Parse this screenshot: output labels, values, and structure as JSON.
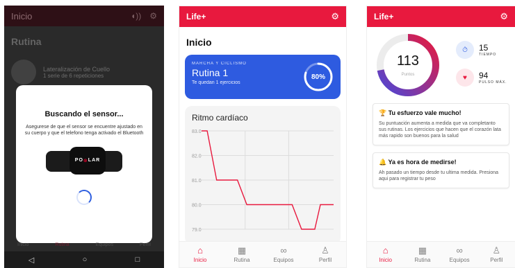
{
  "phone1": {
    "header_title": "Inicio",
    "section_title": "Rutina",
    "item_title": "Lateralización de Cuello",
    "item_sub": "1 serie de 6 repeticiones",
    "modal_title": "Buscando el sensor...",
    "modal_text": "Asegurese de que el sensor se encuentre ajustado en su cuerpo y que el telefono tenga activado el Bluetooth",
    "sensor_brand_left": "PO",
    "sensor_brand_right": "LAR",
    "tabs": [
      "Inicio",
      "Rutina",
      "Equipos",
      "Perfil"
    ]
  },
  "phone2": {
    "app_title": "Life+",
    "page_title": "Inicio",
    "routine": {
      "category": "MARCHA Y CICLISMO",
      "name": "Rutina 1",
      "remaining": "Te quedan 1 ejercicios",
      "progress_label": "80%",
      "progress": 0.8
    },
    "hr_title": "Ritmo cardíaco",
    "chart_data": {
      "type": "line",
      "title": "Ritmo cardíaco",
      "ytick_labels": [
        "83.0",
        "82.0",
        "81.0",
        "80.0",
        "79.0"
      ],
      "ylim": [
        79,
        83
      ],
      "series": [
        {
          "values": [
            83,
            83,
            81,
            81,
            81,
            80,
            80,
            80,
            80,
            80,
            79,
            79,
            80,
            80
          ]
        }
      ],
      "x_index": [
        0,
        0.6,
        1.6,
        3.0,
        3.8,
        4.8,
        6.0,
        7.2,
        8.4,
        9.6,
        10.6,
        12.0,
        12.6,
        14.0
      ],
      "grid": true,
      "color": "#e8193e"
    },
    "nav": [
      {
        "label": "Inicio",
        "icon": "home-icon",
        "active": true
      },
      {
        "label": "Rutina",
        "icon": "calendar-icon",
        "active": false
      },
      {
        "label": "Equipos",
        "icon": "equipment-icon",
        "active": false
      },
      {
        "label": "Perfil",
        "icon": "profile-icon",
        "active": false
      }
    ]
  },
  "phone3": {
    "app_title": "Life+",
    "points_value": "113",
    "points_label": "Puntos",
    "points_progress": 0.72,
    "stat_time_value": "15",
    "stat_time_label": "TIEMPO",
    "stat_pulse_value": "94",
    "stat_pulse_label": "PULSO MÁX.",
    "card1_title": "🏆 Tu esfuerzo vale mucho!",
    "card1_text": "Su puntuación aumenta a medida que va completanto sus rutinas. Los ejercicios que hacen que el corazón lata más rapido son buenos para la salud",
    "card2_title": "🔔 Ya es hora de medirse!",
    "card2_text": "Ah pasado un tiempo desde tu ultima medida. Presiona aqui para registrar tu peso",
    "nav": [
      "Inicio",
      "Rutina",
      "Equipos",
      "Perfil"
    ]
  },
  "colors": {
    "brand": "#e8193e",
    "blue": "#2e5be0",
    "gradient_end": "#4b47d8"
  }
}
